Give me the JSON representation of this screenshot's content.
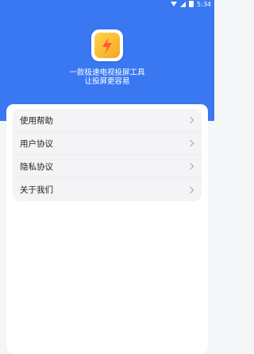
{
  "status_bar": {
    "time": "5:34"
  },
  "header": {
    "tagline_line1": "一款极速电视投屏工具",
    "tagline_line2": "让投屏更容易"
  },
  "menu": {
    "items": [
      {
        "label": "使用帮助"
      },
      {
        "label": "用户协议"
      },
      {
        "label": "隐私协议"
      },
      {
        "label": "关于我们"
      }
    ]
  },
  "colors": {
    "header_blue": "#3a78f2",
    "logo_gradient_start": "#ffd54a",
    "logo_gradient_end": "#f5a524",
    "bolt": "#ff5a2e"
  }
}
